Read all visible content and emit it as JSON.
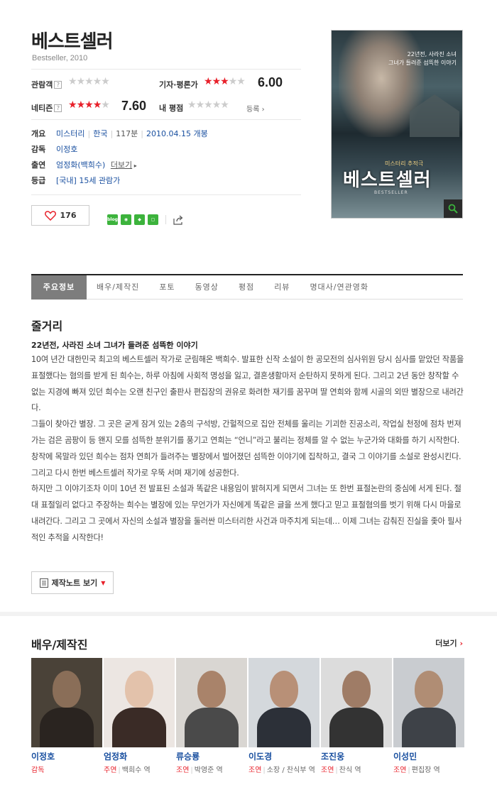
{
  "movie": {
    "title": "베스트셀러",
    "subtitle": "Bestseller, 2010"
  },
  "ratings": {
    "audience_label": "관람객",
    "audience_stars": 0,
    "critic_label": "기자·평론가",
    "critic_stars": 3,
    "critic_score": "6.00",
    "netizen_label": "네티즌",
    "netizen_stars": 4,
    "netizen_score": "7.60",
    "my_label": "내 평점",
    "my_stars": 0,
    "register_label": "등록",
    "help_glyph": "?"
  },
  "info": {
    "overview_key": "개요",
    "genre": "미스터리",
    "country": "한국",
    "runtime": "117분",
    "release": "2010.04.15 개봉",
    "director_key": "감독",
    "director": "이정호",
    "cast_key": "출연",
    "cast": "엄정화(백희수)",
    "cast_more": "더보기",
    "grade_key": "등급",
    "grade_prefix": "[국내]",
    "grade": "15세 관람가"
  },
  "actions": {
    "like_count": "176",
    "share_icons": [
      "blog",
      "cafe",
      "kakao-story",
      "band"
    ]
  },
  "poster": {
    "tagline_line1": "22년전, 사라진 소녀",
    "tagline_line2": "그녀가 들려준 섬뜩한 이야기",
    "sub": "미스터리 추적극",
    "main": "베스트셀러",
    "en": "BESTSELLER"
  },
  "tabs": [
    {
      "label": "주요정보",
      "active": true
    },
    {
      "label": "배우/제작진",
      "active": false
    },
    {
      "label": "포토",
      "active": false
    },
    {
      "label": "동영상",
      "active": false
    },
    {
      "label": "평점",
      "active": false
    },
    {
      "label": "리뷰",
      "active": false
    },
    {
      "label": "명대사/연관영화",
      "active": false
    }
  ],
  "synopsis": {
    "section_title": "줄거리",
    "headline": "22년전, 사라진 소녀 그녀가 들려준 섬뜩한 이야기",
    "p1": "10여 년간 대한민국 최고의 베스트셀러 작가로 군림해온 백희수. 발표한 신작 소설이 한 공모전의 심사위원 당시 심사를 맡았던 작품을 표절했다는 혐의를 받게 된 희수는, 하루 아침에 사회적 명성을 잃고, 결혼생활마저 순탄하지 못하게 된다. 그리고 2년 동안 창작할 수 없는 지경에 빠져 있던 희수는 오랜 친구인 출판사 편집장의 권유로 화려한 재기를 꿈꾸며 딸 연희와 함께 시골의 외딴 별장으로 내려간다.",
    "p2": " 그들이 찾아간 별장. 그 곳은 굳게 잠겨 있는 2층의 구석방, 간헐적으로 집안 전체를 울리는 기괴한 진공소리, 작업실 천정에 점차 번져가는 검은 곰팡이 등 왠지 모를 섬뜩한 분위기를 풍기고 연희는 “언니”라고 불리는 정체를 알 수 없는 누군가와 대화를 하기 시작한다. 창작에 목말라 있던 희수는 점차 연희가 들려주는 별장에서 벌어졌던 섬뜩한 이야기에 집착하고, 결국 그 이야기를 소설로 완성시킨다. 그리고 다시 한번 베스트셀러 작가로 우뚝 서며 재기에 성공한다.",
    "p3": " 하지만 그 이야기조차 이미 10년 전 발표된 소설과 똑같은 내용임이 밝혀지게 되면서 그녀는 또 한번 표절논란의 중심에 서게 된다. 절대 표절일리 없다고 주장하는 희수는 별장에 있는 무언가가 자신에게 똑같은 글을 쓰게 했다고 믿고 표절혐의를 벗기 위해 다시 마을로 내려간다. 그리고 그 곳에서 자신의 소설과 별장을 둘러싼 미스터리한 사건과 마주치게 되는데… 이제 그녀는 감춰진 진실을 좇아 필사적인 추적을 시작한다!",
    "note_button": "제작노트 보기"
  },
  "cast_section": {
    "title": "배우/제작진",
    "more": "더보기",
    "members": [
      {
        "name": "이정호",
        "kind": "감독",
        "role": ""
      },
      {
        "name": "엄정화",
        "kind": "주연",
        "role": "백희수 역"
      },
      {
        "name": "류승룡",
        "kind": "조연",
        "role": "박영준 역"
      },
      {
        "name": "이도경",
        "kind": "조연",
        "role": "소장 / 찬식부 역"
      },
      {
        "name": "조진웅",
        "kind": "조연",
        "role": "찬식 역"
      },
      {
        "name": "이성민",
        "kind": "조연",
        "role": "편집장 역"
      }
    ]
  },
  "colors": {
    "accent": "#e8202a",
    "link": "#1a50a0",
    "tab_active": "#7d7d7d"
  }
}
